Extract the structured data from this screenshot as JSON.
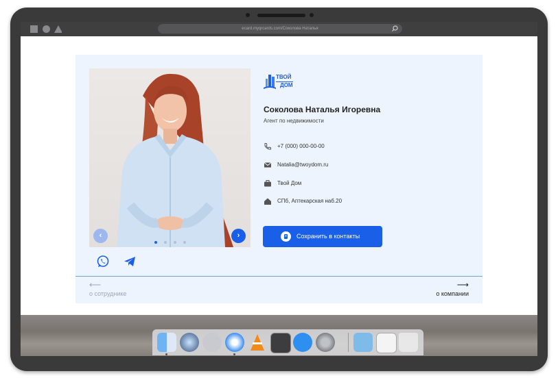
{
  "browser": {
    "url": "ecard.myqrcards.com/Соколова Наталья"
  },
  "card": {
    "brand": {
      "line1": "ТВОЙ",
      "line2": "ДОМ"
    },
    "name": "Соколова Наталья Игоревна",
    "role": "Агент по недвижимости",
    "contacts": [
      {
        "icon": "phone-icon",
        "text": "+7 (000) 000-00-00"
      },
      {
        "icon": "mail-icon",
        "text": "Natalia@twoydom.ru"
      },
      {
        "icon": "briefcase-icon",
        "text": "Твой Дом"
      },
      {
        "icon": "home-icon",
        "text": "СПб, Аптекарская наб.20"
      }
    ],
    "save_button": "Сохранить в контакты",
    "carousel": {
      "prev": "‹",
      "next": "›",
      "slides": 4,
      "active": 1
    },
    "nav": {
      "prev_arrow": "⟵",
      "prev_label": "о сотруднике",
      "next_arrow": "⟶",
      "next_label": "о компании"
    }
  },
  "colors": {
    "accent": "#1a5fe8",
    "card_bg": "#eef4fd",
    "divider": "#6aa6c9",
    "muted": "#9aa6b6"
  },
  "dock": {
    "apps": [
      "finder-icon",
      "siri-icon",
      "launchpad-icon",
      "safari-icon",
      "vlc-icon",
      "terminal-icon",
      "app-store-icon",
      "system-preferences-icon",
      "downloads-folder-icon",
      "preview-icon",
      "trash-icon"
    ]
  }
}
